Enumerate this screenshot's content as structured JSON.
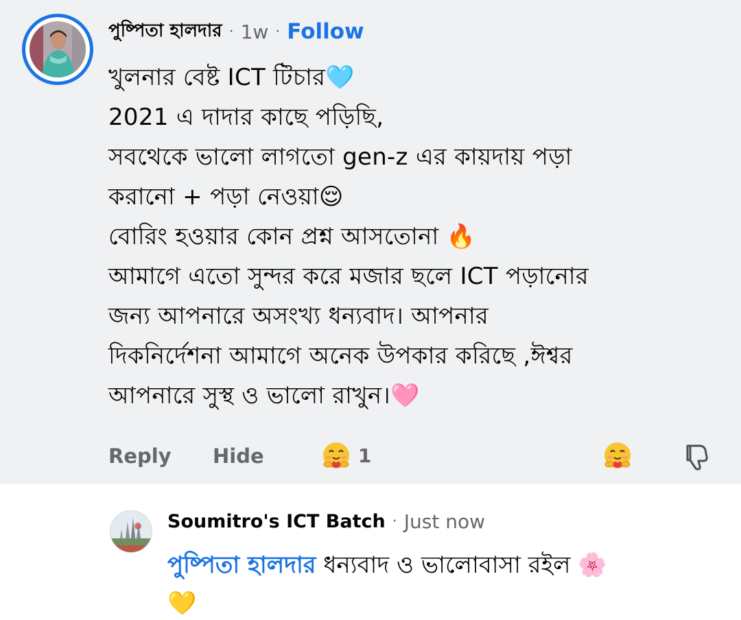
{
  "comment": {
    "author": "পুষ্পিতা হালদার",
    "time": "1w",
    "separator": "·",
    "follow_label": "Follow",
    "lines": [
      "খুলনার বেষ্ট ICT টিচার🩵",
      "2021 এ দাদার কাছে পড়িছি,",
      "সবথেকে ভালো লাগতো gen-z এর কায়দায় পড়া",
      "করানো + পড়া নেওয়া😌",
      "বোরিং হওয়ার কোন প্রশ্ন আসতোনা 🔥",
      "আমাগে  এতো সুন্দর করে মজার ছলে ICT পড়ানোর",
      "জন্য আপনারে অসংখ্য ধন্যবাদ। আপনার",
      "দিকনির্দেশনা আমাগে অনেক উপকার করিছে ,ঈশ্বর",
      "আপনারে সুস্থ ও ভালো রাখুন।🩷"
    ],
    "actions": {
      "reply_label": "Reply",
      "hide_label": "Hide",
      "reaction_count": "1",
      "reaction_icon": "care-hug-emoji-icon",
      "dislike_icon": "thumbs-down-icon"
    },
    "avatar_ring_color": "#1b74e4"
  },
  "reply": {
    "author": "Soumitro's ICT Batch",
    "separator": "·",
    "time": "Just now",
    "mention": "পুষ্পিতা হালদার",
    "text": " ধন্যবাদ ও ভালোবাসা রইল 🌸",
    "line2": "💛"
  },
  "colors": {
    "accent": "#1b74e4",
    "comment_bg": "#f0f1f3",
    "secondary_text": "#65676b",
    "primary_text": "#050505"
  }
}
